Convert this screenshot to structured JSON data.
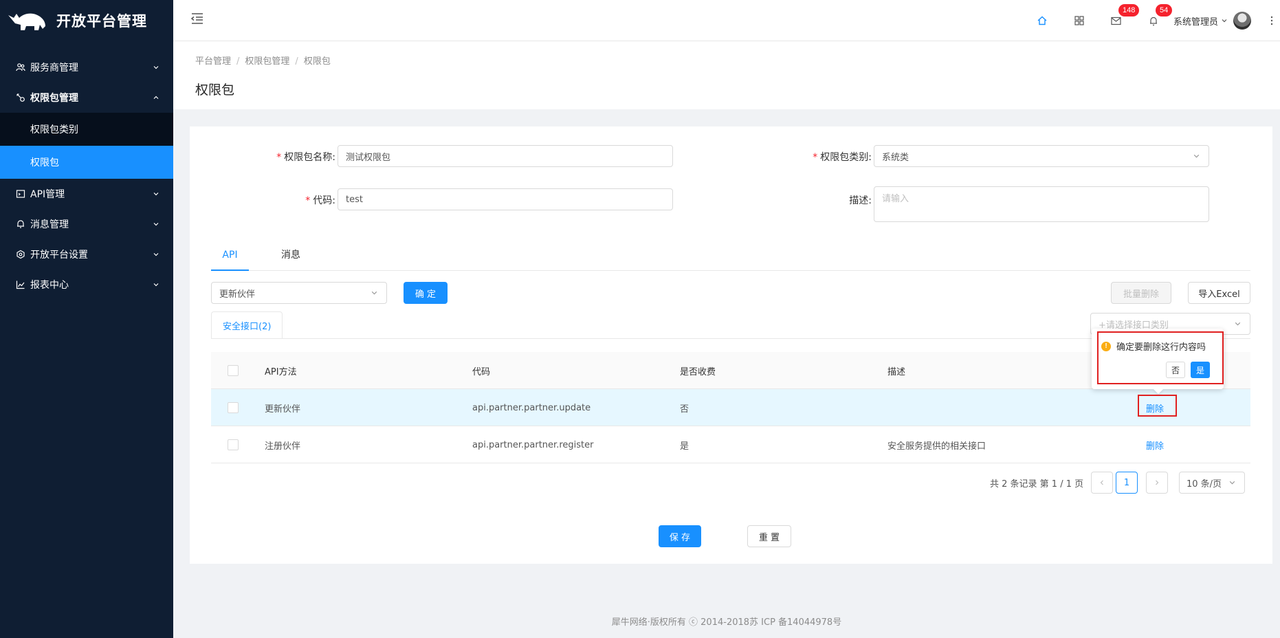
{
  "app": {
    "title": "开放平台管理"
  },
  "sidebar": {
    "items": [
      {
        "label": "服务商管理",
        "icon": "team-icon",
        "expanded": false
      },
      {
        "label": "权限包管理",
        "icon": "key-icon",
        "expanded": true,
        "children": [
          {
            "label": "权限包类别",
            "active": false
          },
          {
            "label": "权限包",
            "active": true
          }
        ]
      },
      {
        "label": "API管理",
        "icon": "api-icon",
        "expanded": false
      },
      {
        "label": "消息管理",
        "icon": "bell-icon",
        "expanded": false
      },
      {
        "label": "开放平台设置",
        "icon": "settings-icon",
        "expanded": false
      },
      {
        "label": "报表中心",
        "icon": "chart-icon",
        "expanded": false
      }
    ]
  },
  "header": {
    "mail_badge": "148",
    "bell_badge": "54",
    "user_name": "系统管理员"
  },
  "breadcrumb": [
    "平台管理",
    "权限包管理",
    "权限包"
  ],
  "page_title": "权限包",
  "form": {
    "name_label": "权限包名称:",
    "name_value": "测试权限包",
    "category_label": "权限包类别:",
    "category_value": "系统类",
    "code_label": "代码:",
    "code_value": "test",
    "desc_label": "描述:",
    "desc_placeholder": "请输入"
  },
  "tabs": [
    "API",
    "消息"
  ],
  "toolbar": {
    "select_value": "更新伙伴",
    "confirm_label": "确 定",
    "batch_delete_label": "批量删除",
    "import_label": "导入Excel",
    "category_filter_placeholder": "+请选择接口类别"
  },
  "card_tab": "安全接口(2)",
  "table": {
    "columns": [
      "API方法",
      "代码",
      "是否收费",
      "描述"
    ],
    "rows": [
      {
        "method": "更新伙伴",
        "code": "api.partner.partner.update",
        "charge": "否",
        "desc": "",
        "action": "删除"
      },
      {
        "method": "注册伙伴",
        "code": "api.partner.partner.register",
        "charge": "是",
        "desc": "安全服务提供的相关接口",
        "action": "删除"
      }
    ]
  },
  "pagination": {
    "summary": "共 2 条记录 第 1 / 1 页",
    "current": "1",
    "page_size": "10 条/页"
  },
  "popconfirm": {
    "message": "确定要删除这行内容吗",
    "no": "否",
    "yes": "是"
  },
  "actions": {
    "save": "保 存",
    "reset": "重 置"
  },
  "footer": "犀牛网络·版权所有 ⓒ 2014-2018苏 ICP 备14044978号",
  "colors": {
    "primary": "#1890ff",
    "sidebar": "#0f1e33",
    "danger": "#f5222d",
    "warning": "#faad14",
    "highlight_box": "#e02020"
  }
}
